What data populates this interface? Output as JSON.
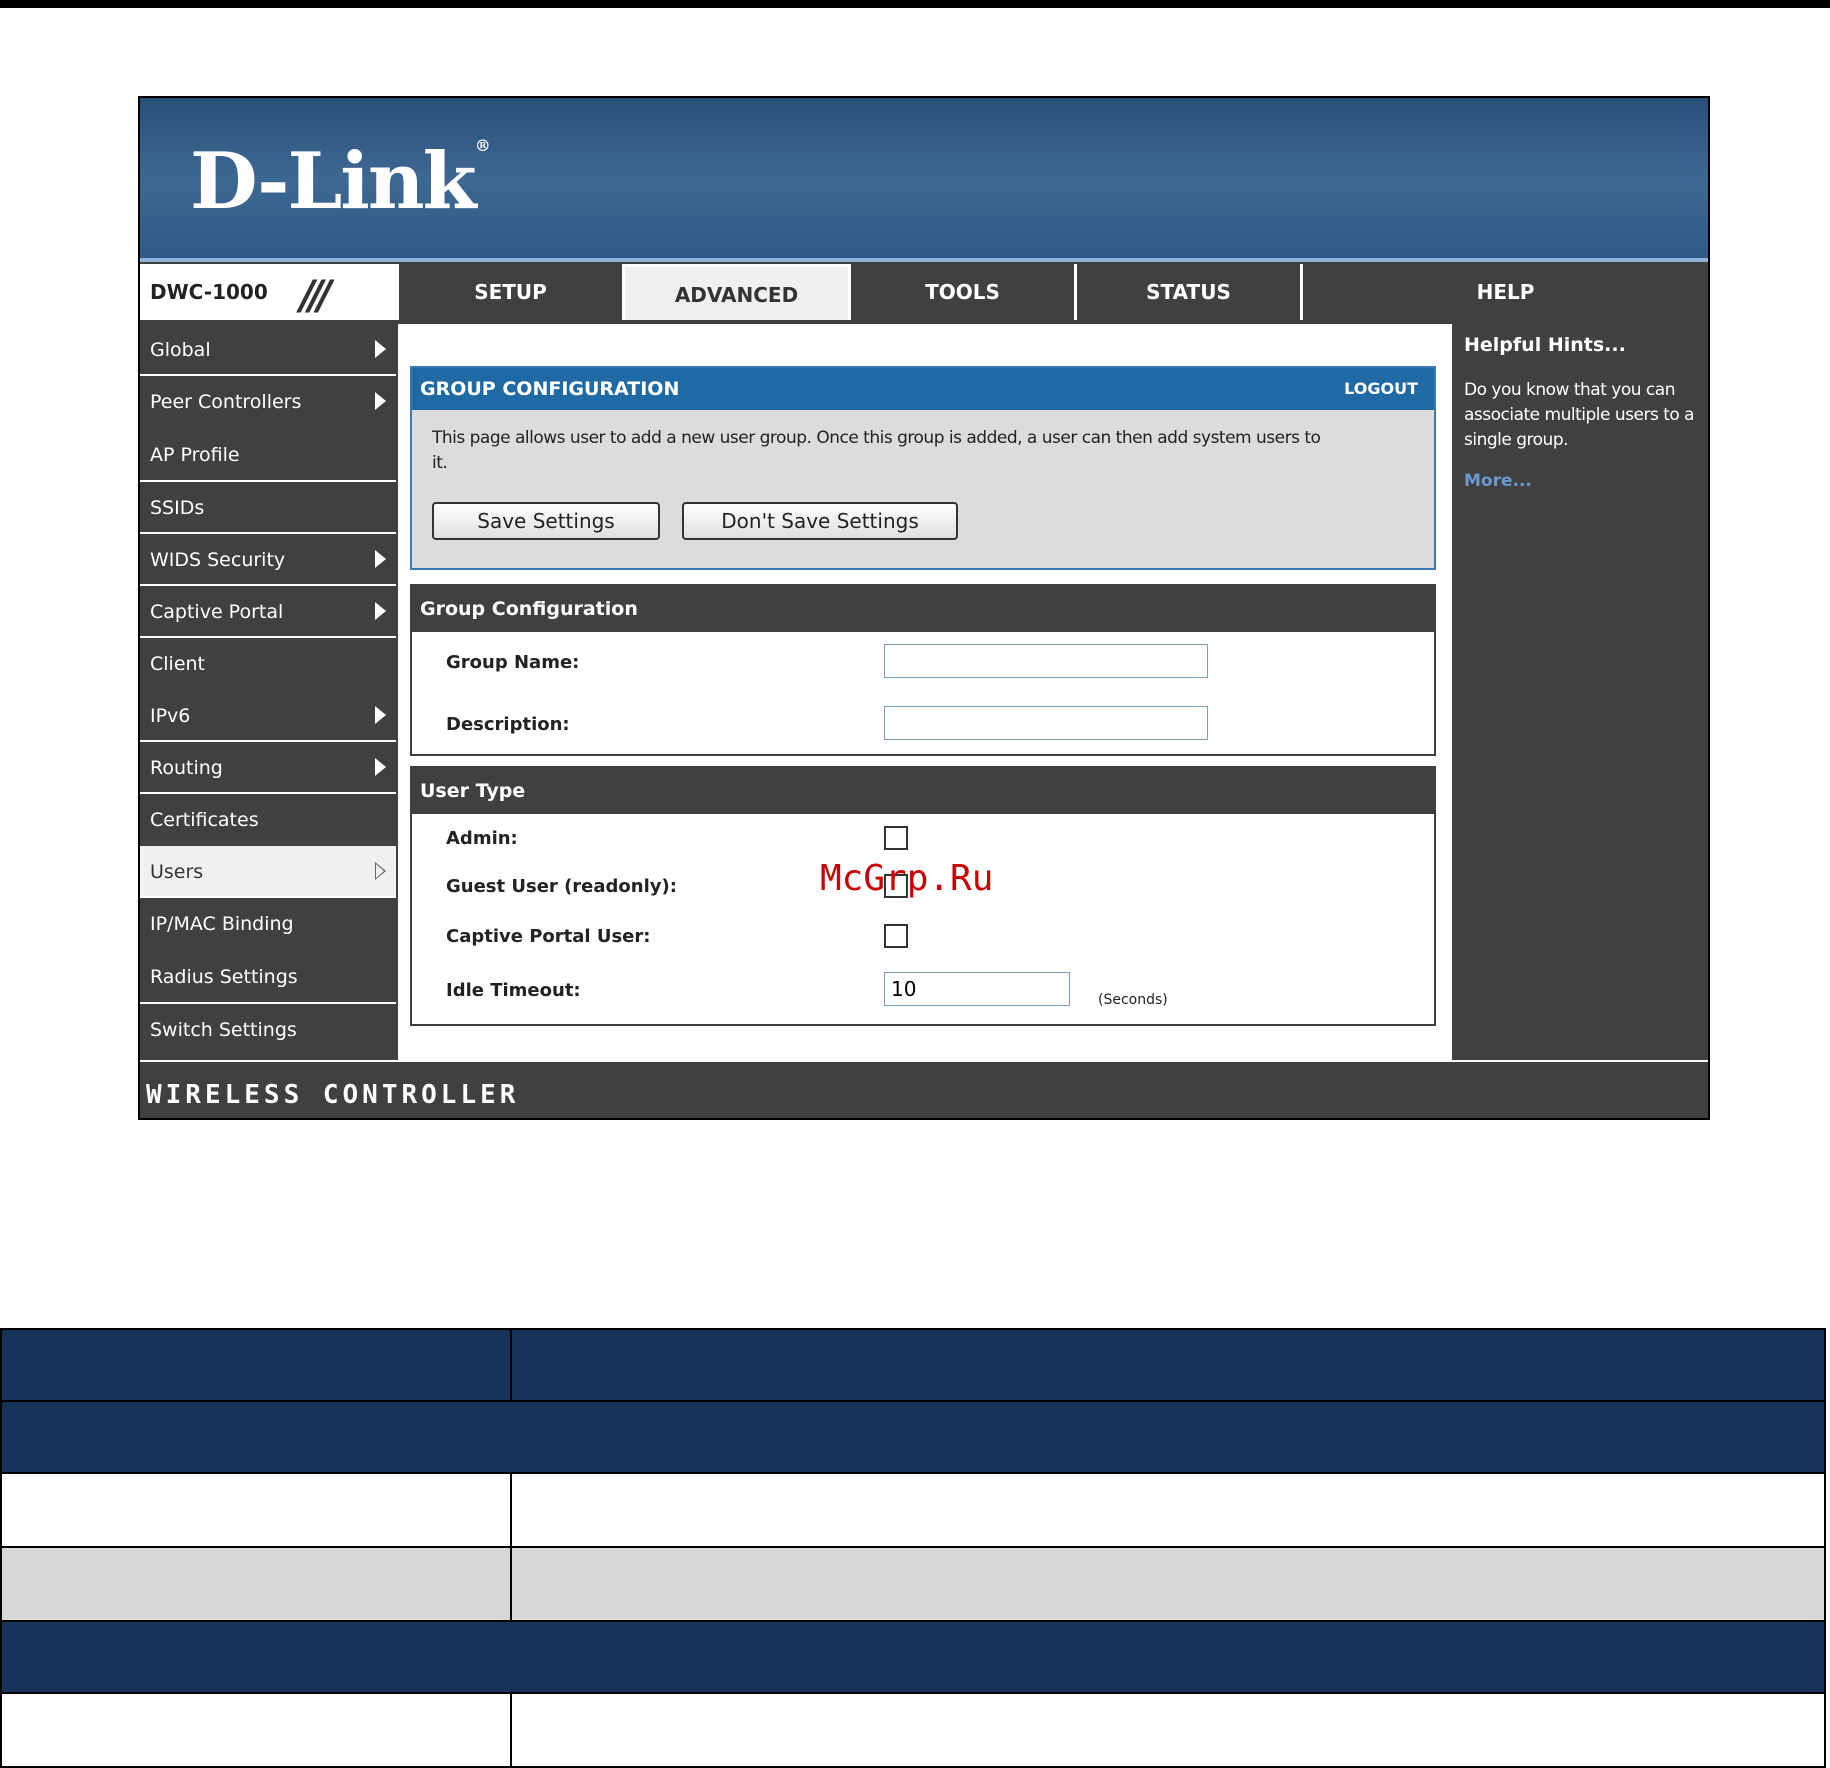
{
  "brand": {
    "logo_text": "D-Link",
    "registered_mark": "®",
    "model": "DWC-1000",
    "footer_text": "WIRELESS CONTROLLER"
  },
  "tabs": [
    {
      "label": "SETUP",
      "active": false
    },
    {
      "label": "ADVANCED",
      "active": true
    },
    {
      "label": "TOOLS",
      "active": false
    },
    {
      "label": "STATUS",
      "active": false
    },
    {
      "label": "HELP",
      "active": false
    }
  ],
  "sidebar": {
    "items": [
      {
        "label": "Global",
        "has_submenu": true
      },
      {
        "label": "Peer Controllers",
        "has_submenu": true
      },
      {
        "label": "AP Profile",
        "has_submenu": false
      },
      {
        "label": "SSIDs",
        "has_submenu": false
      },
      {
        "label": "WIDS Security",
        "has_submenu": true
      },
      {
        "label": "Captive Portal",
        "has_submenu": true
      },
      {
        "label": "Client",
        "has_submenu": false
      },
      {
        "label": "IPv6",
        "has_submenu": true
      },
      {
        "label": "Routing",
        "has_submenu": true
      },
      {
        "label": "Certificates",
        "has_submenu": false
      },
      {
        "label": "Users",
        "has_submenu": true,
        "active": true
      },
      {
        "label": "IP/MAC Binding",
        "has_submenu": false
      },
      {
        "label": "Radius Settings",
        "has_submenu": false
      },
      {
        "label": "Switch Settings",
        "has_submenu": false
      }
    ]
  },
  "main": {
    "title": "GROUP CONFIGURATION",
    "logout_label": "LOGOUT",
    "description": "This page allows user to add a new user group. Once this group is added, a user can then add system users to it.",
    "save_label": "Save Settings",
    "dont_save_label": "Don't Save Settings",
    "group_section": {
      "title": "Group Configuration",
      "group_name_label": "Group Name:",
      "group_name_value": "",
      "description_label": "Description:",
      "description_value": ""
    },
    "user_type_section": {
      "title": "User Type",
      "admin_label": "Admin:",
      "admin_checked": false,
      "guest_label": "Guest User (readonly):",
      "guest_checked": false,
      "captive_label": "Captive Portal User:",
      "captive_checked": false,
      "idle_label": "Idle Timeout:",
      "idle_value": "10",
      "idle_unit": "(Seconds)"
    }
  },
  "hints": {
    "title": "Helpful Hints...",
    "text": "Do you know that you can associate multiple users to a single group.",
    "more": "More..."
  },
  "watermark": "McGrp.Ru",
  "colors": {
    "banner": "#2e5985",
    "nav": "#404040",
    "header_blue": "#1f6aa5",
    "table_header": "#18335a",
    "watermark": "#cc0000"
  }
}
